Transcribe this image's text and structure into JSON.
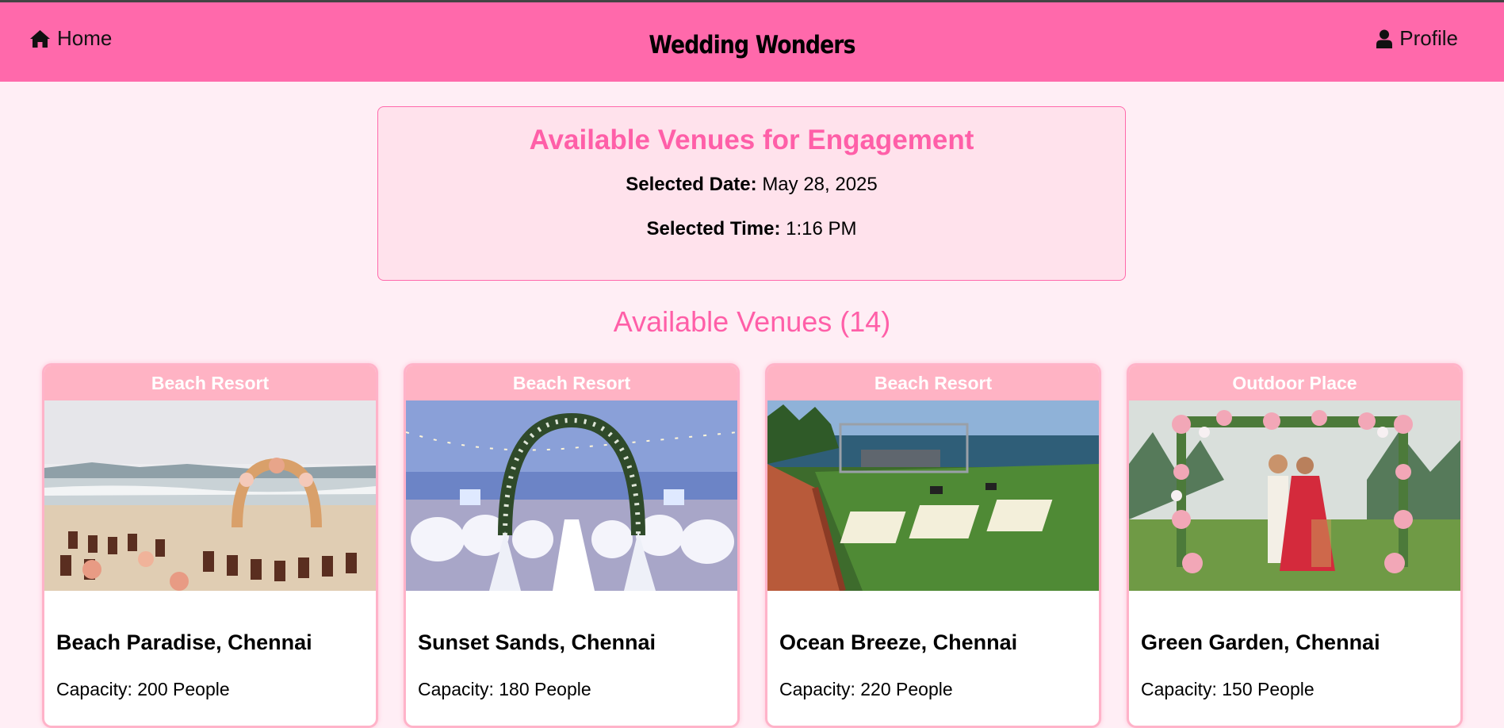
{
  "nav": {
    "home_icon": "home-icon",
    "home_label": "Home",
    "brand": "Wedding Wonders",
    "profile_icon": "user-icon",
    "profile_label": "Profile",
    "bar_color": "#ff69ab"
  },
  "selection": {
    "title": "Available Venues for Engagement",
    "date_label": "Selected Date:",
    "date_value": "May 28, 2025",
    "time_label": "Selected Time:",
    "time_value": "1:16 PM"
  },
  "venues": {
    "heading": "Available Venues (14)",
    "items": [
      {
        "category": "Beach Resort",
        "name": "Beach Paradise, Chennai",
        "capacity": "Capacity: 200 People",
        "image": "beach arch with wooden chairs"
      },
      {
        "category": "Beach Resort",
        "name": "Sunset Sands, Chennai",
        "capacity": "Capacity: 180 People",
        "image": "floral arch with white aisle and covered chairs"
      },
      {
        "category": "Beach Resort",
        "name": "Ocean Breeze, Chennai",
        "capacity": "Capacity: 220 People",
        "image": "seaside lawn with stage and rows of chairs"
      },
      {
        "category": "Outdoor Place",
        "name": "Green Garden, Chennai",
        "capacity": "Capacity: 150 People",
        "image": "couple under flower mandap in garden"
      }
    ]
  },
  "colors": {
    "accent": "#ff5fa8",
    "background": "#ffeef5",
    "card_header": "#ffb3c4",
    "card_border": "#ffb3c9"
  }
}
